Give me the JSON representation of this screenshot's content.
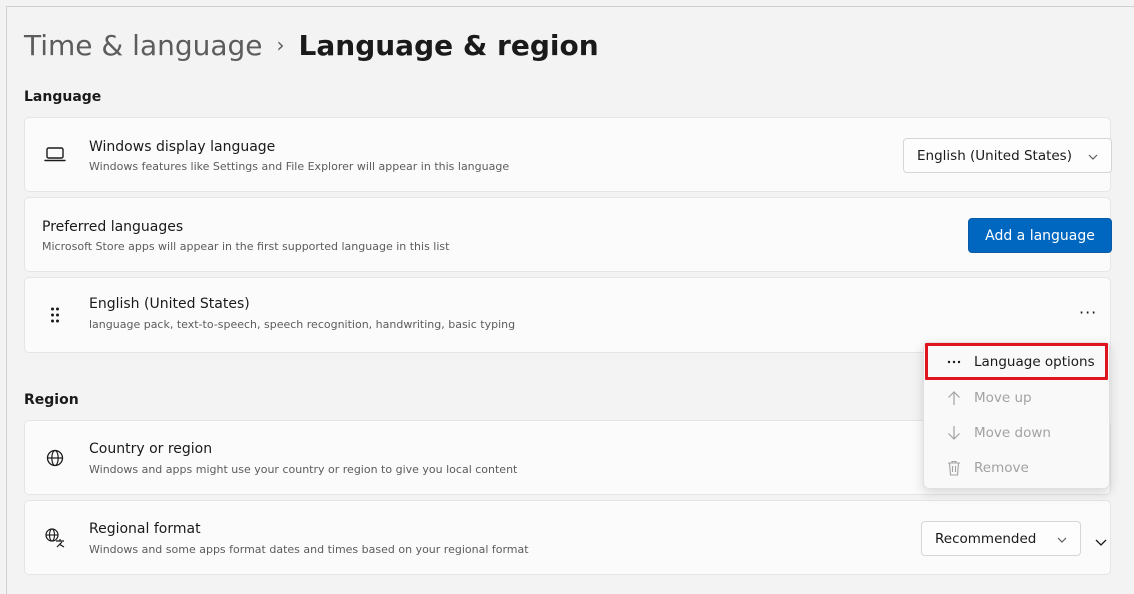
{
  "breadcrumb": {
    "parent": "Time & language",
    "separator": "›",
    "current": "Language & region"
  },
  "sections": {
    "language": "Language",
    "region": "Region"
  },
  "display_language": {
    "title": "Windows display language",
    "subtitle": "Windows features like Settings and File Explorer will appear in this language",
    "value": "English (United States)",
    "icon": "laptop-icon"
  },
  "preferred_languages": {
    "title": "Preferred languages",
    "subtitle": "Microsoft Store apps will appear in the first supported language in this list",
    "button": "Add a language"
  },
  "language_entry": {
    "title": "English (United States)",
    "subtitle": "language pack, text-to-speech, speech recognition, handwriting, basic typing",
    "more": "···",
    "icon": "drag-handle-icon"
  },
  "context_menu": {
    "items": [
      {
        "label": "Language options",
        "icon": "more-icon",
        "enabled": true
      },
      {
        "label": "Move up",
        "icon": "arrow-up-icon",
        "enabled": false
      },
      {
        "label": "Move down",
        "icon": "arrow-down-icon",
        "enabled": false
      },
      {
        "label": "Remove",
        "icon": "trash-icon",
        "enabled": false
      }
    ]
  },
  "country": {
    "title": "Country or region",
    "subtitle": "Windows and apps might use your country or region to give you local content",
    "icon": "globe-icon"
  },
  "regional_format": {
    "title": "Regional format",
    "subtitle": "Windows and some apps format dates and times based on your regional format",
    "value": "Recommended",
    "icon": "globe-language-icon"
  },
  "colors": {
    "accent": "#0067c0",
    "highlight": "#e0141e"
  }
}
